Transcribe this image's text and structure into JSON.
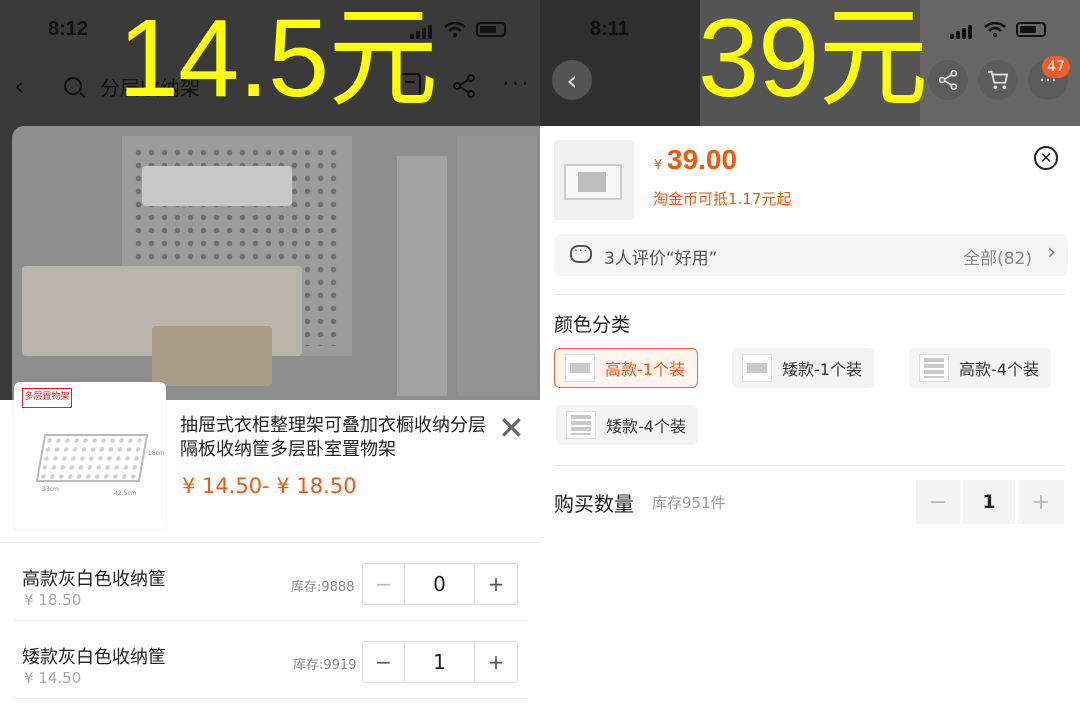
{
  "left": {
    "overlay_price": "14.5元",
    "status_time": "8:12",
    "search_text": "分层收纳架",
    "product_title": "抽屉式衣柜整理架可叠加衣橱收纳分层隔板收纳筐多层卧室置物架",
    "price_range": "¥ 14.50- ¥ 18.50",
    "thumb_tag": "多层置物架",
    "thumb_dims": [
      "33cm",
      "42.5cm",
      "18cm"
    ],
    "items": [
      {
        "name": "高款灰白色收纳筐",
        "price": "¥ 18.50",
        "stock": "库存:9888",
        "qty": "0",
        "minus": "−",
        "plus": "+"
      },
      {
        "name": "矮款灰白色收纳筐",
        "price": "¥ 14.50",
        "stock": "库存:9919",
        "qty": "1",
        "minus": "−",
        "plus": "+"
      }
    ],
    "close_glyph": "✕",
    "back_glyph": "‹"
  },
  "right": {
    "overlay_price": "39元",
    "status_time": "8:11",
    "currency": "¥",
    "price": "39.00",
    "coin_note": "淘金币可抵1.17元起",
    "cart_badge": "47",
    "review_text": "3人评价“好用”",
    "review_all": "全部(82)",
    "section_title": "颜色分类",
    "options": [
      {
        "label": "高款-1个装",
        "selected": true
      },
      {
        "label": "矮款-1个装",
        "selected": false
      },
      {
        "label": "高款-4个装",
        "selected": false
      },
      {
        "label": "矮款-4个装",
        "selected": false
      }
    ],
    "qty_label": "购买数量",
    "stock_text": "库存951件",
    "qty": "1",
    "minus": "−",
    "plus": "+"
  },
  "colors": {
    "accent": "#f05a0c",
    "overlay_text": "#ffff00"
  }
}
